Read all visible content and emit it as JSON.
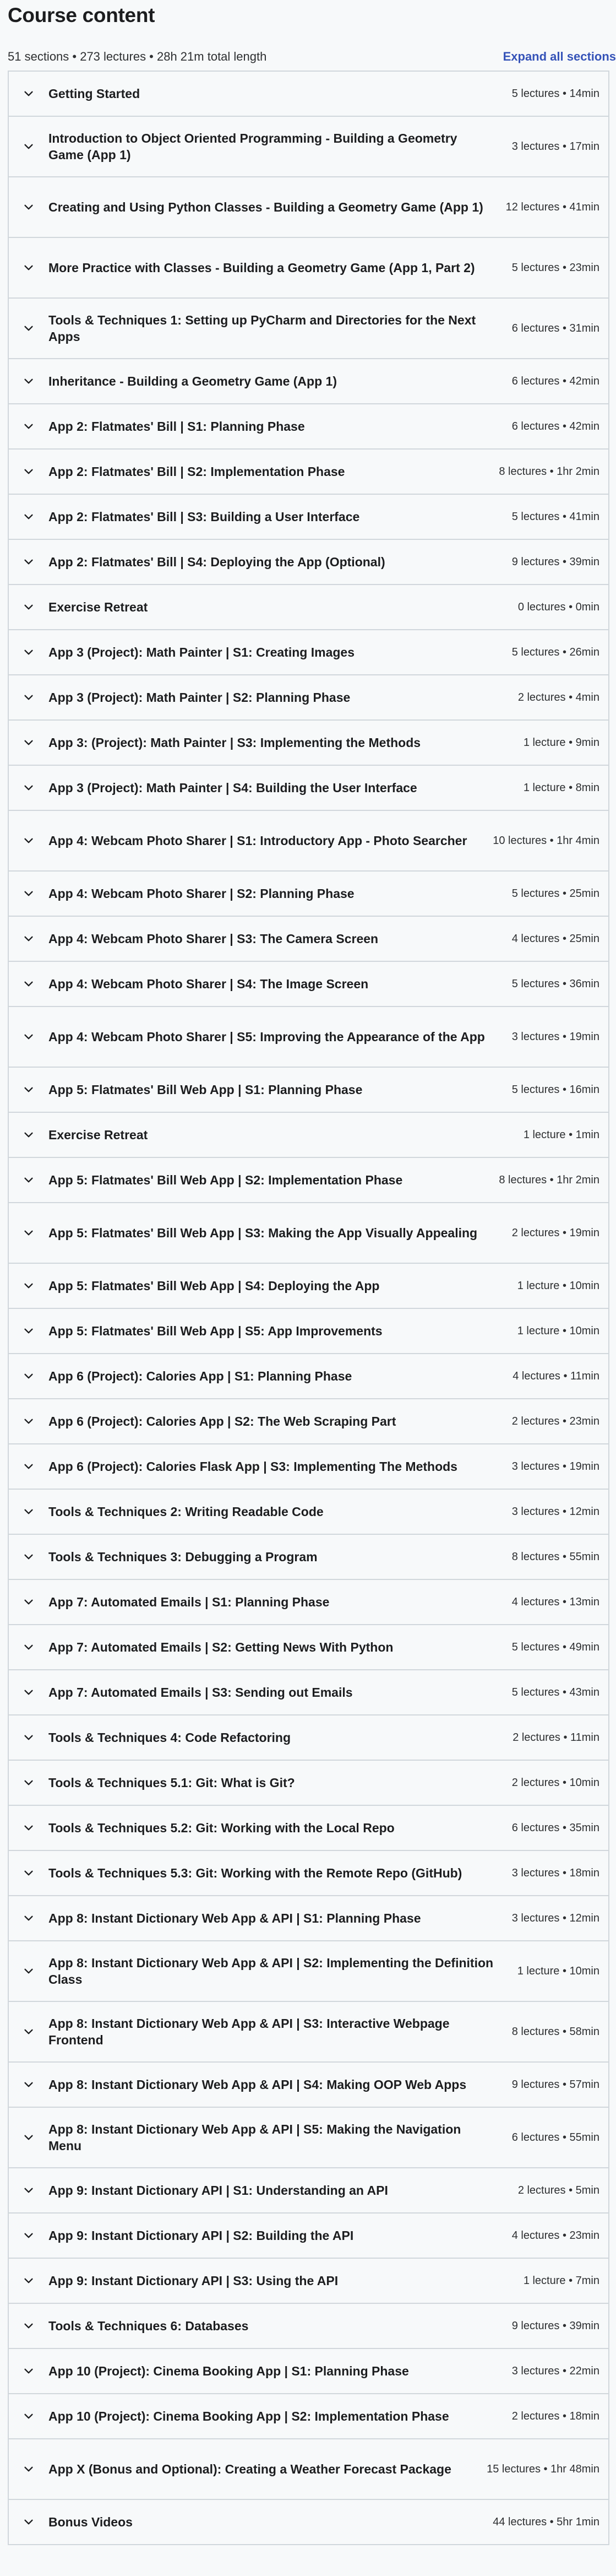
{
  "header": {
    "title": "Course content",
    "summary": "51 sections • 273 lectures • 28h 21m total length",
    "expand_label": "Expand all sections"
  },
  "sections": [
    {
      "title": "Getting Started",
      "meta": "5 lectures • 14min"
    },
    {
      "title": "Introduction to Object Oriented Programming - Building a Geometry Game (App 1)",
      "meta": "3 lectures • 17min"
    },
    {
      "title": "Creating and Using Python Classes - Building a Geometry Game (App 1)",
      "meta": "12 lectures • 41min"
    },
    {
      "title": "More Practice with Classes - Building a Geometry Game (App 1, Part 2)",
      "meta": "5 lectures • 23min"
    },
    {
      "title": "Tools & Techniques 1: Setting up PyCharm and Directories for the Next Apps",
      "meta": "6 lectures • 31min"
    },
    {
      "title": "Inheritance - Building a Geometry Game (App 1)",
      "meta": "6 lectures • 42min"
    },
    {
      "title": "App 2: Flatmates' Bill | S1: Planning Phase",
      "meta": "6 lectures • 42min"
    },
    {
      "title": "App 2: Flatmates' Bill | S2: Implementation Phase",
      "meta": "8 lectures • 1hr 2min"
    },
    {
      "title": "App 2: Flatmates' Bill | S3: Building a User Interface",
      "meta": "5 lectures • 41min"
    },
    {
      "title": "App 2: Flatmates' Bill | S4: Deploying the App (Optional)",
      "meta": "9 lectures • 39min"
    },
    {
      "title": "Exercise Retreat",
      "meta": "0 lectures • 0min"
    },
    {
      "title": "App 3 (Project): Math Painter | S1: Creating Images",
      "meta": "5 lectures • 26min"
    },
    {
      "title": "App 3 (Project): Math Painter | S2: Planning Phase",
      "meta": "2 lectures • 4min"
    },
    {
      "title": "App 3: (Project): Math Painter | S3: Implementing the Methods",
      "meta": "1 lecture • 9min"
    },
    {
      "title": "App 3 (Project): Math Painter | S4: Building the User Interface",
      "meta": "1 lecture • 8min"
    },
    {
      "title": "App 4: Webcam Photo Sharer | S1: Introductory App - Photo Searcher",
      "meta": "10 lectures • 1hr 4min"
    },
    {
      "title": "App 4: Webcam Photo Sharer | S2: Planning Phase",
      "meta": "5 lectures • 25min"
    },
    {
      "title": "App 4: Webcam Photo Sharer | S3: The Camera Screen",
      "meta": "4 lectures • 25min"
    },
    {
      "title": "App 4: Webcam Photo Sharer | S4: The Image Screen",
      "meta": "5 lectures • 36min"
    },
    {
      "title": "App 4: Webcam Photo Sharer | S5: Improving the Appearance of the App",
      "meta": "3 lectures • 19min"
    },
    {
      "title": "App 5: Flatmates' Bill Web App | S1: Planning Phase",
      "meta": "5 lectures • 16min"
    },
    {
      "title": "Exercise Retreat",
      "meta": "1 lecture • 1min"
    },
    {
      "title": "App 5: Flatmates' Bill Web App | S2: Implementation Phase",
      "meta": "8 lectures • 1hr 2min"
    },
    {
      "title": "App 5: Flatmates' Bill Web App | S3: Making the App Visually Appealing",
      "meta": "2 lectures • 19min"
    },
    {
      "title": "App 5: Flatmates' Bill Web App | S4: Deploying the App",
      "meta": "1 lecture • 10min"
    },
    {
      "title": "App 5: Flatmates' Bill Web App | S5: App Improvements",
      "meta": "1 lecture • 10min"
    },
    {
      "title": "App 6 (Project): Calories App | S1: Planning Phase",
      "meta": "4 lectures • 11min"
    },
    {
      "title": "App 6 (Project): Calories App | S2: The Web Scraping Part",
      "meta": "2 lectures • 23min"
    },
    {
      "title": "App 6 (Project): Calories Flask App | S3: Implementing The Methods",
      "meta": "3 lectures • 19min"
    },
    {
      "title": "Tools & Techniques 2: Writing Readable Code",
      "meta": "3 lectures • 12min"
    },
    {
      "title": "Tools & Techniques 3: Debugging a Program",
      "meta": "8 lectures • 55min"
    },
    {
      "title": "App 7: Automated Emails | S1: Planning Phase",
      "meta": "4 lectures • 13min"
    },
    {
      "title": "App 7: Automated Emails | S2: Getting News With Python",
      "meta": "5 lectures • 49min"
    },
    {
      "title": "App 7: Automated Emails | S3: Sending out Emails",
      "meta": "5 lectures • 43min"
    },
    {
      "title": "Tools & Techniques 4: Code Refactoring",
      "meta": "2 lectures • 11min"
    },
    {
      "title": "Tools & Techniques 5.1: Git: What is Git?",
      "meta": "2 lectures • 10min"
    },
    {
      "title": "Tools & Techniques 5.2: Git: Working with the Local Repo",
      "meta": "6 lectures • 35min"
    },
    {
      "title": "Tools & Techniques 5.3: Git: Working with the Remote Repo (GitHub)",
      "meta": "3 lectures • 18min"
    },
    {
      "title": "App 8: Instant Dictionary Web App & API | S1: Planning Phase",
      "meta": "3 lectures • 12min"
    },
    {
      "title": "App 8: Instant Dictionary Web App & API | S2: Implementing the Definition Class",
      "meta": "1 lecture • 10min"
    },
    {
      "title": "App 8: Instant Dictionary Web App & API | S3: Interactive Webpage Frontend",
      "meta": "8 lectures • 58min"
    },
    {
      "title": "App 8: Instant Dictionary Web App & API | S4: Making OOP Web Apps",
      "meta": "9 lectures • 57min"
    },
    {
      "title": "App 8: Instant Dictionary Web App & API | S5: Making the Navigation Menu",
      "meta": "6 lectures • 55min"
    },
    {
      "title": "App 9: Instant Dictionary API | S1: Understanding an API",
      "meta": "2 lectures • 5min"
    },
    {
      "title": "App 9: Instant Dictionary API | S2: Building the API",
      "meta": "4 lectures • 23min"
    },
    {
      "title": "App 9: Instant Dictionary API | S3: Using the API",
      "meta": "1 lecture • 7min"
    },
    {
      "title": "Tools & Techniques 6: Databases",
      "meta": "9 lectures • 39min"
    },
    {
      "title": "App 10 (Project): Cinema Booking App | S1: Planning Phase",
      "meta": "3 lectures • 22min"
    },
    {
      "title": "App 10 (Project): Cinema Booking App | S2: Implementation Phase",
      "meta": "2 lectures • 18min"
    },
    {
      "title": "App X (Bonus and Optional): Creating a Weather Forecast Package",
      "meta": "15 lectures • 1hr 48min"
    },
    {
      "title": "Bonus Videos",
      "meta": "44 lectures • 5hr 1min"
    }
  ]
}
